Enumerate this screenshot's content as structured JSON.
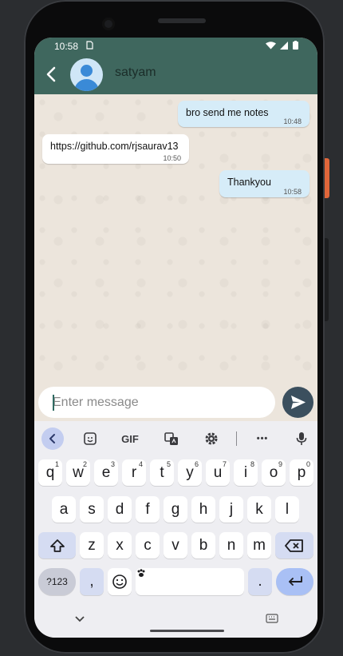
{
  "status_bar": {
    "time": "10:58"
  },
  "header": {
    "contact_name": "satyam"
  },
  "messages": [
    {
      "text": "bro send me notes",
      "time": "10:48"
    },
    {
      "text": "https://github.com/rjsaurav13",
      "time": "10:50"
    },
    {
      "text": "Thankyou",
      "time": "10:58"
    }
  ],
  "input": {
    "placeholder": "Enter message",
    "value": ""
  },
  "keyboard": {
    "toolbar": {
      "gif_label": "GIF",
      "more_label": "•••"
    },
    "row1": [
      {
        "key": "q",
        "hint": "1"
      },
      {
        "key": "w",
        "hint": "2"
      },
      {
        "key": "e",
        "hint": "3"
      },
      {
        "key": "r",
        "hint": "4"
      },
      {
        "key": "t",
        "hint": "5"
      },
      {
        "key": "y",
        "hint": "6"
      },
      {
        "key": "u",
        "hint": "7"
      },
      {
        "key": "i",
        "hint": "8"
      },
      {
        "key": "o",
        "hint": "9"
      },
      {
        "key": "p",
        "hint": "0"
      }
    ],
    "row2": [
      "a",
      "s",
      "d",
      "f",
      "g",
      "h",
      "j",
      "k",
      "l"
    ],
    "row3": [
      "z",
      "x",
      "c",
      "v",
      "b",
      "n",
      "m"
    ],
    "symbols_label": "?123",
    "comma_label": ",",
    "period_label": "."
  },
  "colors": {
    "appbar": "#3f675e",
    "outgoing_bubble": "#d6ecf8",
    "incoming_bubble": "#ffffff",
    "send_button": "#3b4f5e"
  }
}
